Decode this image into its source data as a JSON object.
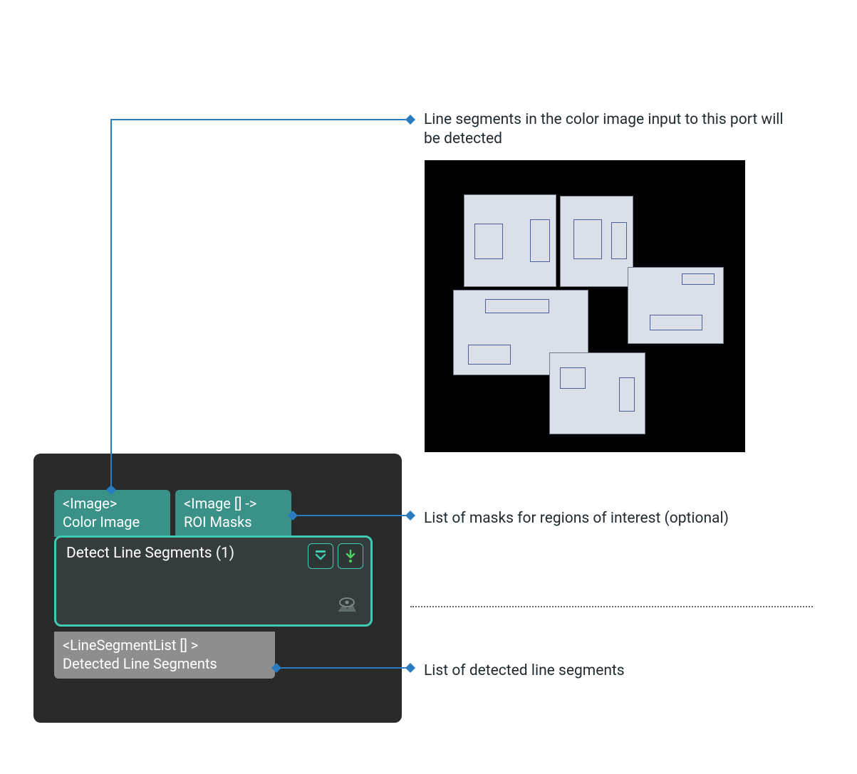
{
  "annotations": {
    "color_image": "Line segments in the color image input to this port will be detected",
    "roi_masks": "List of masks for regions of interest (optional)",
    "output": "List of detected line segments"
  },
  "node": {
    "input_ports": {
      "port1": {
        "type": "<Image>",
        "label": "Color Image"
      },
      "port2": {
        "type": "<Image [] ->",
        "label": "ROI Masks"
      }
    },
    "title": "Detect Line Segments (1)",
    "output_port": {
      "type": "<LineSegmentList [] >",
      "label": "Detected Line Segments"
    }
  },
  "icons": {
    "expand": "expand-down-icon",
    "download": "download-icon",
    "preview": "eye-image-icon"
  }
}
